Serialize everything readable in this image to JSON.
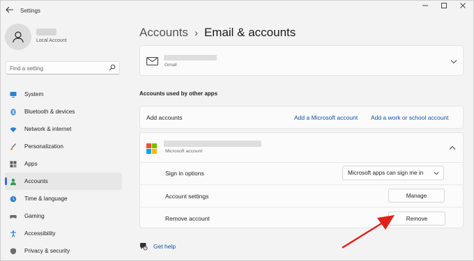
{
  "window": {
    "title": "Settings",
    "back_icon": "back-arrow-icon",
    "controls": [
      "minimize-icon",
      "maximize-icon",
      "close-icon"
    ]
  },
  "sidebar": {
    "user": {
      "subtitle": "Local Account"
    },
    "search": {
      "placeholder": "Find a setting"
    },
    "items": [
      {
        "label": "System",
        "icon": "system-monitor-icon",
        "color": "#2d7fd3"
      },
      {
        "label": "Bluetooth & devices",
        "icon": "bluetooth-icon",
        "color": "#2d7fd3"
      },
      {
        "label": "Network & internet",
        "icon": "wifi-icon",
        "color": "#2d7fd3"
      },
      {
        "label": "Personalization",
        "icon": "brush-icon",
        "color": "#d9822b"
      },
      {
        "label": "Apps",
        "icon": "apps-icon",
        "color": "#5a5a5a"
      },
      {
        "label": "Accounts",
        "icon": "person-icon",
        "color": "#2e9e5b",
        "active": true
      },
      {
        "label": "Time & language",
        "icon": "globe-clock-icon",
        "color": "#2d7fd3"
      },
      {
        "label": "Gaming",
        "icon": "gamepad-icon",
        "color": "#6b6b6b"
      },
      {
        "label": "Accessibility",
        "icon": "accessibility-icon",
        "color": "#2d7fd3"
      },
      {
        "label": "Privacy & security",
        "icon": "shield-icon",
        "color": "#6b6b6b"
      }
    ]
  },
  "main": {
    "breadcrumb": {
      "parent": "Accounts",
      "separator": "›",
      "current": "Email & accounts"
    },
    "gmail_account": {
      "provider": "Gmail"
    },
    "other_apps_section": {
      "title": "Accounts used by other apps",
      "add_label": "Add accounts",
      "add_microsoft": "Add a Microsoft account",
      "add_work": "Add a work or school account"
    },
    "microsoft_account": {
      "provider": "Microsoft account",
      "sign_in_label": "Sign in options",
      "sign_in_value": "Microsoft apps can sign me in",
      "settings_label": "Account settings",
      "manage_label": "Manage",
      "remove_label": "Remove account",
      "remove_button": "Remove"
    },
    "help": {
      "label": "Get help"
    }
  },
  "colors": {
    "accent": "#3b6fd1",
    "link": "#0e4ea8",
    "annotation_arrow": "#e0201b"
  }
}
